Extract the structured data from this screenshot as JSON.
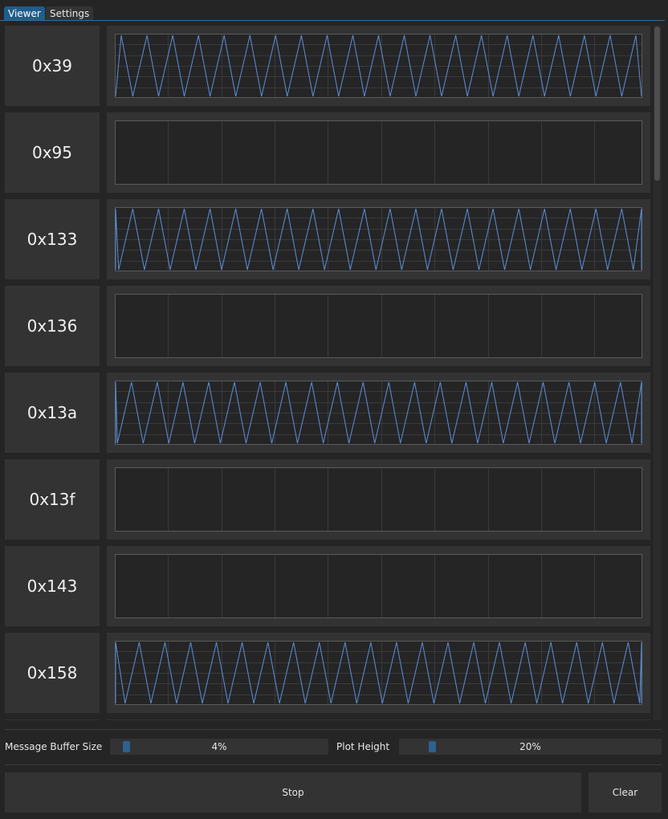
{
  "tabs": [
    {
      "label": "Viewer",
      "active": true
    },
    {
      "label": "Settings",
      "active": false
    }
  ],
  "colors": {
    "background": "#252526",
    "panel": "#333334",
    "accent": "#1f5d8c",
    "plot_line": "#5b8fd6",
    "plot_bg": "#252526"
  },
  "messages": [
    {
      "id": "0x39",
      "has_signal": true,
      "periods": 20.5,
      "phase": 0.3,
      "chart_data": {
        "type": "line",
        "waveform": "sawtooth",
        "ylim": [
          0,
          1
        ]
      }
    },
    {
      "id": "0x95",
      "has_signal": false,
      "chart_data": {
        "type": "line",
        "series": []
      }
    },
    {
      "id": "0x133",
      "has_signal": true,
      "periods": 20.5,
      "phase": 0.85,
      "chart_data": {
        "type": "line",
        "waveform": "sawtooth",
        "ylim": [
          0,
          1
        ]
      }
    },
    {
      "id": "0x136",
      "has_signal": false,
      "chart_data": {
        "type": "line",
        "series": []
      }
    },
    {
      "id": "0x13a",
      "has_signal": true,
      "periods": 20.5,
      "phase": 0.9,
      "chart_data": {
        "type": "line",
        "waveform": "sawtooth",
        "ylim": [
          0,
          1
        ]
      }
    },
    {
      "id": "0x13f",
      "has_signal": false,
      "chart_data": {
        "type": "line",
        "series": []
      }
    },
    {
      "id": "0x143",
      "has_signal": false,
      "chart_data": {
        "type": "line",
        "series": []
      }
    },
    {
      "id": "0x158",
      "has_signal": true,
      "periods": 20.5,
      "phase": 0.6,
      "chart_data": {
        "type": "line",
        "waveform": "sawtooth",
        "ylim": [
          0,
          1
        ]
      }
    }
  ],
  "controls": {
    "buffer_label": "Message Buffer Size",
    "buffer_value": "4%",
    "buffer_fraction": 0.04,
    "plot_height_label": "Plot Height",
    "plot_height_value": "20%",
    "plot_height_fraction": 0.2
  },
  "buttons": {
    "stop": "Stop",
    "clear": "Clear"
  },
  "scrollbar": {
    "visible_fraction": 0.22
  }
}
